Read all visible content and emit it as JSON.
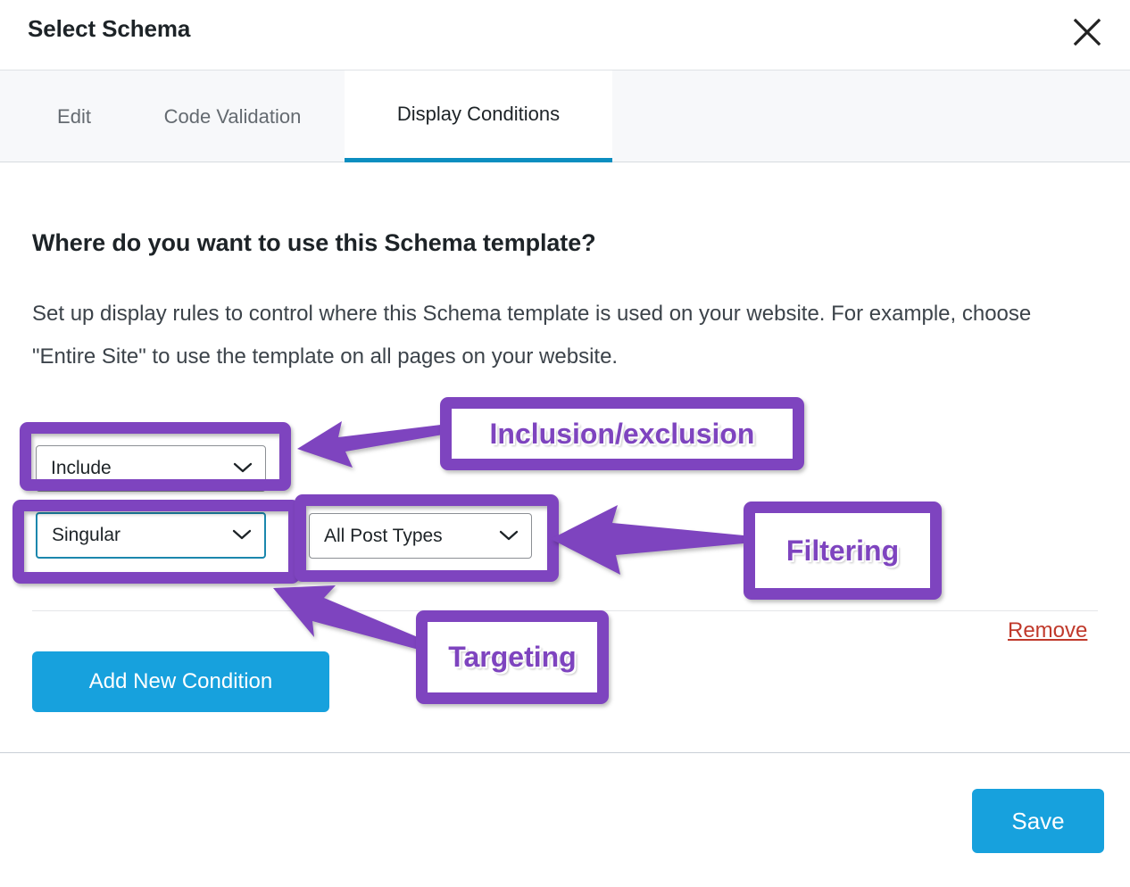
{
  "window": {
    "title": "Select Schema",
    "close_icon": "close-icon"
  },
  "tabs": [
    {
      "label": "Edit",
      "active": false
    },
    {
      "label": "Code Validation",
      "active": false
    },
    {
      "label": "Display Conditions",
      "active": true
    }
  ],
  "main": {
    "heading": "Where do you want to use this Schema template?",
    "description": "Set up display rules to control where this Schema template is used on your website. For example, choose \"Entire Site\" to use the template on all pages on your website.",
    "condition_row": {
      "inclusion_select": {
        "value": "Include",
        "icon": "chevron-down-icon"
      },
      "targeting_select": {
        "value": "Singular",
        "icon": "chevron-down-icon",
        "focused": true
      },
      "filtering_select": {
        "value": "All Post Types",
        "icon": "chevron-down-icon"
      },
      "remove_label": "Remove"
    },
    "add_condition_label": "Add New Condition"
  },
  "footer": {
    "save_label": "Save"
  },
  "annotations": {
    "inclusion_label": "Inclusion/exclusion",
    "filtering_label": "Filtering",
    "targeting_label": "Targeting",
    "highlight_color": "#7e44bf"
  },
  "colors": {
    "accent_blue": "#17a1dd",
    "tab_underline": "#0c8ec0",
    "remove_red": "#c0392b",
    "annotation_purple": "#7e44bf",
    "focus_border": "#1b87ad"
  }
}
